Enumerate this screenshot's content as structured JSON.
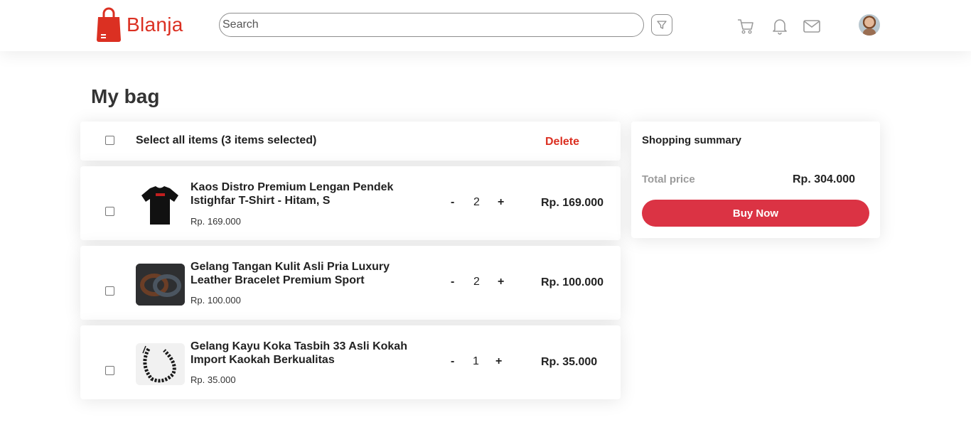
{
  "header": {
    "brand": "Blanja",
    "search_placeholder": "Search",
    "icons": [
      "filter-icon",
      "cart-icon",
      "bell-icon",
      "mail-icon"
    ]
  },
  "page_title": "My bag",
  "select_all": {
    "label": "Select all items (3 items selected)",
    "delete_label": "Delete"
  },
  "items": [
    {
      "name": "Kaos Distro Premium Lengan Pendek Istighfar T-Shirt - Hitam, S",
      "unit_price": "Rp. 169.000",
      "qty": "2",
      "total": "Rp. 169.000",
      "thumb": "black-tshirt"
    },
    {
      "name": "Gelang Tangan Kulit Asli Pria Luxury Leather Bracelet Premium Sport",
      "unit_price": "Rp. 100.000",
      "qty": "2",
      "total": "Rp. 100.000",
      "thumb": "leather-bracelet"
    },
    {
      "name": "Gelang Kayu Koka Tasbih 33 Asli Kokah Import Kaokah Berkualitas",
      "unit_price": "Rp. 35.000",
      "qty": "1",
      "total": "Rp. 35.000",
      "thumb": "wood-bead-bracelet"
    }
  ],
  "qty_controls": {
    "minus": "-",
    "plus": "+"
  },
  "summary": {
    "title": "Shopping summary",
    "total_label": "Total price",
    "total_value": "Rp. 304.000",
    "buy_label": "Buy Now"
  },
  "colors": {
    "brand": "#DB3022",
    "button": "#DB3344"
  }
}
